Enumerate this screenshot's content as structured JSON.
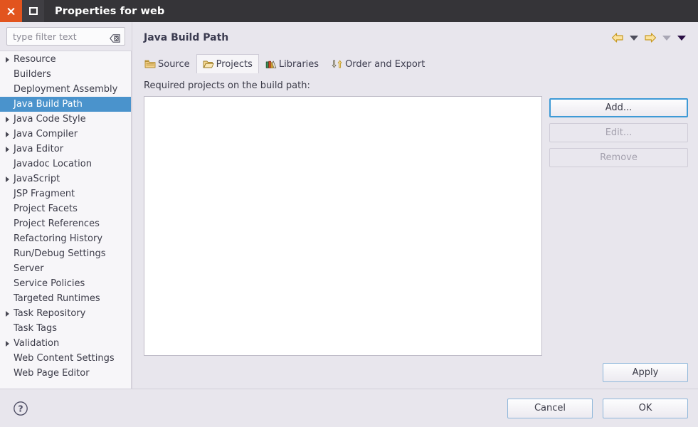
{
  "window": {
    "title": "Properties for web",
    "close_label": "close-window",
    "maximize_label": "maximize-window"
  },
  "sidebar": {
    "filter": {
      "value": "",
      "placeholder": "type filter text",
      "clear_icon": "clear-icon"
    },
    "items": [
      {
        "label": "Resource",
        "expandable": true,
        "selected": false
      },
      {
        "label": "Builders",
        "expandable": false,
        "selected": false
      },
      {
        "label": "Deployment Assembly",
        "expandable": false,
        "selected": false
      },
      {
        "label": "Java Build Path",
        "expandable": false,
        "selected": true
      },
      {
        "label": "Java Code Style",
        "expandable": true,
        "selected": false
      },
      {
        "label": "Java Compiler",
        "expandable": true,
        "selected": false
      },
      {
        "label": "Java Editor",
        "expandable": true,
        "selected": false
      },
      {
        "label": "Javadoc Location",
        "expandable": false,
        "selected": false
      },
      {
        "label": "JavaScript",
        "expandable": true,
        "selected": false
      },
      {
        "label": "JSP Fragment",
        "expandable": false,
        "selected": false
      },
      {
        "label": "Project Facets",
        "expandable": false,
        "selected": false
      },
      {
        "label": "Project References",
        "expandable": false,
        "selected": false
      },
      {
        "label": "Refactoring History",
        "expandable": false,
        "selected": false
      },
      {
        "label": "Run/Debug Settings",
        "expandable": false,
        "selected": false
      },
      {
        "label": "Server",
        "expandable": false,
        "selected": false
      },
      {
        "label": "Service Policies",
        "expandable": false,
        "selected": false
      },
      {
        "label": "Targeted Runtimes",
        "expandable": false,
        "selected": false
      },
      {
        "label": "Task Repository",
        "expandable": true,
        "selected": false
      },
      {
        "label": "Task Tags",
        "expandable": false,
        "selected": false
      },
      {
        "label": "Validation",
        "expandable": true,
        "selected": false
      },
      {
        "label": "Web Content Settings",
        "expandable": false,
        "selected": false
      },
      {
        "label": "Web Page Editor",
        "expandable": false,
        "selected": false
      }
    ]
  },
  "page": {
    "title": "Java Build Path",
    "nav": {
      "back_icon": "back-arrow-icon",
      "back_menu_icon": "chevron-down-icon",
      "forward_icon": "forward-arrow-icon",
      "forward_menu_icon": "chevron-down-icon",
      "overflow_menu_icon": "chevron-down-icon"
    },
    "tabs": [
      {
        "label": "Source",
        "icon": "source-folder-icon",
        "active": false
      },
      {
        "label": "Projects",
        "icon": "open-folder-icon",
        "active": true
      },
      {
        "label": "Libraries",
        "icon": "books-icon",
        "active": false
      },
      {
        "label": "Order and Export",
        "icon": "order-arrows-icon",
        "active": false
      }
    ],
    "panel": {
      "label": "Required projects on the build path:",
      "list_items": [],
      "buttons": [
        {
          "label": "Add...",
          "state": "focused"
        },
        {
          "label": "Edit...",
          "state": "disabled"
        },
        {
          "label": "Remove",
          "state": "disabled"
        }
      ],
      "apply_label": "Apply"
    }
  },
  "footer": {
    "help_icon": "help-circle-icon",
    "buttons": [
      {
        "label": "Cancel"
      },
      {
        "label": "OK"
      }
    ]
  },
  "colors": {
    "titlebar_bg": "#353438",
    "close_btn": "#e2541e",
    "dialog_bg": "#e8e6ed",
    "selection_blue": "#4a93cc",
    "focus_blue": "#3e9ad6",
    "list_bg": "#ffffff"
  }
}
